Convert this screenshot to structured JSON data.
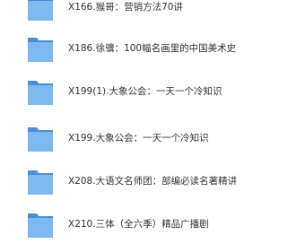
{
  "explorer": {
    "items": [
      {
        "name": "X166.猴哥：营销方法70讲",
        "icon": "folder-icon"
      },
      {
        "name": "X186.徐骥：100幅名画里的中国美术史",
        "icon": "folder-icon"
      },
      {
        "name": "X199(1).大象公会：一天一个冷知识",
        "icon": "folder-icon"
      },
      {
        "name": "X199.大象公会：一天一个冷知识",
        "icon": "folder-icon"
      },
      {
        "name": "X208.大语文名师团：部编必读名著精讲",
        "icon": "folder-icon"
      },
      {
        "name": "X210.三体（全六季）精品广播剧",
        "icon": "folder-icon"
      }
    ]
  },
  "colors": {
    "folder_body": "#5ea2e6",
    "folder_tab": "#4a8fd6",
    "folder_front": "#7fb8ee",
    "text": "#333333"
  }
}
